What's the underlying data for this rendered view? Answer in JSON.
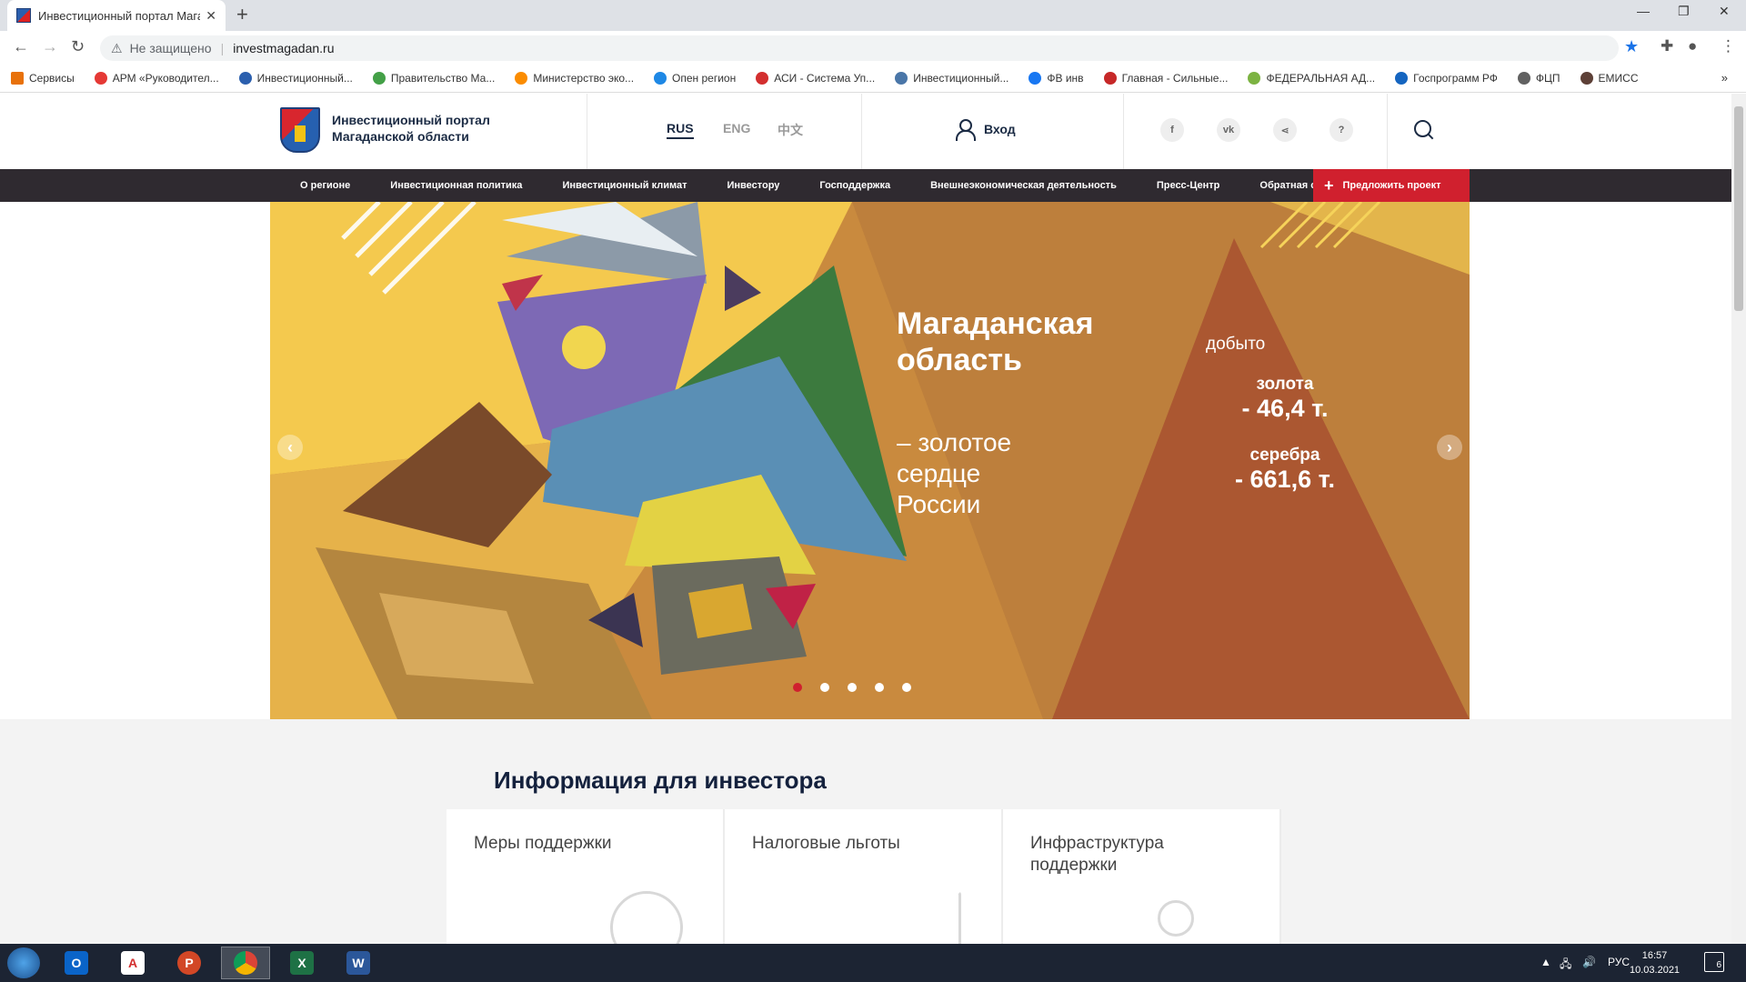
{
  "browser": {
    "tab_title": "Инвестиционный портал Магад",
    "security_label": "Не защищено",
    "url": "investmagadan.ru",
    "bookmarks": [
      {
        "label": "Сервисы",
        "color": "#e8710a"
      },
      {
        "label": "АРМ «Руководител...",
        "color": "#e53935"
      },
      {
        "label": "Инвестиционный...",
        "color": "#2b5fae"
      },
      {
        "label": "Правительство Ма...",
        "color": "#43a047"
      },
      {
        "label": "Министерство эко...",
        "color": "#fb8c00"
      },
      {
        "label": "Опен регион",
        "color": "#1e88e5"
      },
      {
        "label": "АСИ - Система Уп...",
        "color": "#d32f2f"
      },
      {
        "label": "Инвестиционный...",
        "color": "#4a76a8"
      },
      {
        "label": "ФВ инв",
        "color": "#1877f2"
      },
      {
        "label": "Главная - Сильные...",
        "color": "#c62828"
      },
      {
        "label": "ФЕДЕРАЛЬНАЯ АД...",
        "color": "#7cb342"
      },
      {
        "label": "Госпрограмм РФ",
        "color": "#1565c0"
      },
      {
        "label": "ФЦП",
        "color": "#616161"
      },
      {
        "label": "ЕМИСС",
        "color": "#5d4037"
      }
    ]
  },
  "header": {
    "site_title_line1": "Инвестиционный портал",
    "site_title_line2": "Магаданской области",
    "languages": [
      "RUS",
      "ENG",
      "中文"
    ],
    "login_label": "Вход",
    "social": [
      "f",
      "vk",
      "<",
      "?"
    ]
  },
  "nav": {
    "items": [
      "О регионе",
      "Инвестиционная политика",
      "Инвестиционный климат",
      "Инвестору",
      "Господдержка",
      "Внешнеэкономическая деятельность",
      "Пресс-Центр",
      "Обратная связь"
    ],
    "propose_label": "Предложить проект"
  },
  "hero": {
    "title_line1": "Магаданская",
    "title_line2": "область",
    "subtitle": "– золотое\nсердце\nРоссии",
    "mined_label": "добыто",
    "gold_name": "золота",
    "gold_value": "- 46,4 т.",
    "silver_name": "серебра",
    "silver_value": "- 661,6 т.",
    "slides_count": 5,
    "active_slide": 1
  },
  "info": {
    "heading": "Информация для инвестора",
    "cards": [
      "Меры поддержки",
      "Налоговые льготы",
      "Инфраструктура\nподдержки"
    ]
  },
  "taskbar": {
    "lang": "РУС",
    "time": "16:57",
    "date": "10.03.2021",
    "notifications": "6"
  }
}
